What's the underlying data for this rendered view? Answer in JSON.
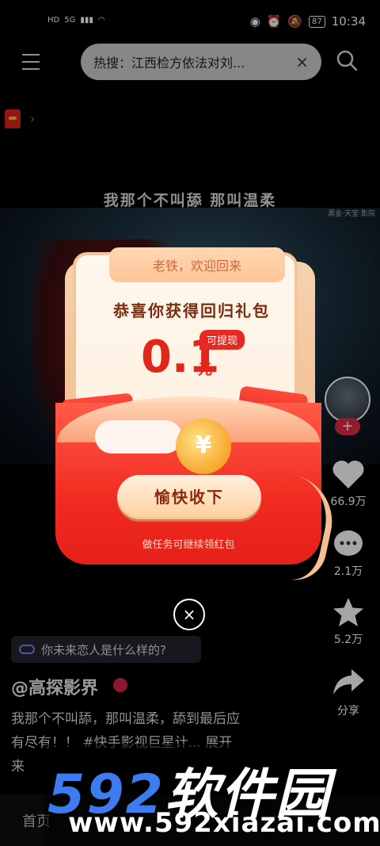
{
  "status_bar": {
    "network": "HD",
    "signal": "5G",
    "battery": "87",
    "time": "10:34"
  },
  "search": {
    "hot_text": "热搜：江西检方依法对刘...",
    "close": "×"
  },
  "video": {
    "subtitle": "我那个不叫舔 那叫温柔",
    "corner_watermark": "黑金·天堂·影院"
  },
  "popup": {
    "tab": "老铁，欢迎回来",
    "title": "恭喜你获得回归礼包",
    "amount": "0.1",
    "unit": "元",
    "tag": "可提现",
    "coin": "¥",
    "button": "愉快收下",
    "hint": "做任务可继续领红包",
    "close": "×"
  },
  "actions": {
    "like_count": "66.9万",
    "comment_count": "2.1万",
    "favorite_count": "5.2万",
    "share_label": "分享",
    "follow_plus": "+"
  },
  "info": {
    "topic": "你未来恋人是什么样的?",
    "author": "@高探影界",
    "description_line1": "我那个不叫舔，那叫温柔，舔到最后应",
    "description_line2": "有尽有！！ #快手影视巨星计... 展开",
    "extra": "来"
  },
  "bottom_nav": {
    "home": "首页"
  },
  "site_watermark": {
    "big_num": "592",
    "big_cn": "软件园",
    "url": "www.592xiazai.com"
  }
}
